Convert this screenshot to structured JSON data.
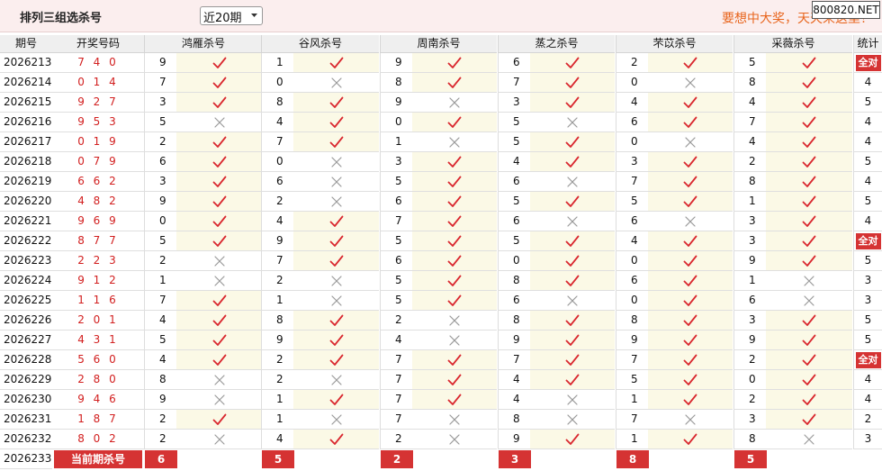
{
  "header": {
    "title": "排列三组选杀号",
    "range_value": "近20期",
    "promo": "要想中大奖，天天来这里！",
    "watermark": "800820.NET"
  },
  "columns": {
    "period": "期号",
    "number": "开奖号码",
    "groups": [
      "鸿雁杀号",
      "谷风杀号",
      "周南杀号",
      "蒸之杀号",
      "芣苡杀号",
      "采薇杀号"
    ],
    "stats": "统计"
  },
  "rows": [
    {
      "period": "2026213",
      "number": "7 4 0",
      "kills": [
        9,
        1,
        9,
        6,
        2,
        5
      ],
      "hits": [
        1,
        1,
        1,
        1,
        1,
        1
      ],
      "stat": "全对",
      "all": true
    },
    {
      "period": "2026214",
      "number": "0 1 4",
      "kills": [
        7,
        0,
        8,
        7,
        0,
        8
      ],
      "hits": [
        1,
        0,
        1,
        1,
        0,
        1
      ],
      "stat": "4",
      "all": false
    },
    {
      "period": "2026215",
      "number": "9 2 7",
      "kills": [
        3,
        8,
        9,
        3,
        4,
        4
      ],
      "hits": [
        1,
        1,
        0,
        1,
        1,
        1
      ],
      "stat": "5",
      "all": false
    },
    {
      "period": "2026216",
      "number": "9 5 3",
      "kills": [
        5,
        4,
        0,
        5,
        6,
        7
      ],
      "hits": [
        0,
        1,
        1,
        0,
        1,
        1
      ],
      "stat": "4",
      "all": false
    },
    {
      "period": "2026217",
      "number": "0 1 9",
      "kills": [
        2,
        7,
        1,
        5,
        0,
        4
      ],
      "hits": [
        1,
        1,
        0,
        1,
        0,
        1
      ],
      "stat": "4",
      "all": false
    },
    {
      "period": "2026218",
      "number": "0 7 9",
      "kills": [
        6,
        0,
        3,
        4,
        3,
        2
      ],
      "hits": [
        1,
        0,
        1,
        1,
        1,
        1
      ],
      "stat": "5",
      "all": false
    },
    {
      "period": "2026219",
      "number": "6 6 2",
      "kills": [
        3,
        6,
        5,
        6,
        7,
        8
      ],
      "hits": [
        1,
        0,
        1,
        0,
        1,
        1
      ],
      "stat": "4",
      "all": false
    },
    {
      "period": "2026220",
      "number": "4 8 2",
      "kills": [
        9,
        2,
        6,
        5,
        5,
        1
      ],
      "hits": [
        1,
        0,
        1,
        1,
        1,
        1
      ],
      "stat": "5",
      "all": false
    },
    {
      "period": "2026221",
      "number": "9 6 9",
      "kills": [
        0,
        4,
        7,
        6,
        6,
        3
      ],
      "hits": [
        1,
        1,
        1,
        0,
        0,
        1
      ],
      "stat": "4",
      "all": false
    },
    {
      "period": "2026222",
      "number": "8 7 7",
      "kills": [
        5,
        9,
        5,
        5,
        4,
        3
      ],
      "hits": [
        1,
        1,
        1,
        1,
        1,
        1
      ],
      "stat": "全对",
      "all": true
    },
    {
      "period": "2026223",
      "number": "2 2 3",
      "kills": [
        2,
        7,
        6,
        0,
        0,
        9
      ],
      "hits": [
        0,
        1,
        1,
        1,
        1,
        1
      ],
      "stat": "5",
      "all": false
    },
    {
      "period": "2026224",
      "number": "9 1 2",
      "kills": [
        1,
        2,
        5,
        8,
        6,
        1
      ],
      "hits": [
        0,
        0,
        1,
        1,
        1,
        0
      ],
      "stat": "3",
      "all": false
    },
    {
      "period": "2026225",
      "number": "1 1 6",
      "kills": [
        7,
        1,
        5,
        6,
        0,
        6
      ],
      "hits": [
        1,
        0,
        1,
        0,
        1,
        0
      ],
      "stat": "3",
      "all": false
    },
    {
      "period": "2026226",
      "number": "2 0 1",
      "kills": [
        4,
        8,
        2,
        8,
        8,
        3
      ],
      "hits": [
        1,
        1,
        0,
        1,
        1,
        1
      ],
      "stat": "5",
      "all": false
    },
    {
      "period": "2026227",
      "number": "4 3 1",
      "kills": [
        5,
        9,
        4,
        9,
        9,
        9
      ],
      "hits": [
        1,
        1,
        0,
        1,
        1,
        1
      ],
      "stat": "5",
      "all": false
    },
    {
      "period": "2026228",
      "number": "5 6 0",
      "kills": [
        4,
        2,
        7,
        7,
        7,
        2
      ],
      "hits": [
        1,
        1,
        1,
        1,
        1,
        1
      ],
      "stat": "全对",
      "all": true
    },
    {
      "period": "2026229",
      "number": "2 8 0",
      "kills": [
        8,
        2,
        7,
        4,
        5,
        0
      ],
      "hits": [
        0,
        0,
        1,
        1,
        1,
        1
      ],
      "stat": "4",
      "all": false
    },
    {
      "period": "2026230",
      "number": "9 4 6",
      "kills": [
        9,
        1,
        7,
        4,
        1,
        2
      ],
      "hits": [
        0,
        1,
        1,
        0,
        1,
        1
      ],
      "stat": "4",
      "all": false
    },
    {
      "period": "2026231",
      "number": "1 8 7",
      "kills": [
        2,
        1,
        7,
        8,
        7,
        3
      ],
      "hits": [
        1,
        0,
        0,
        0,
        0,
        1
      ],
      "stat": "2",
      "all": false
    },
    {
      "period": "2026232",
      "number": "8 0 2",
      "kills": [
        2,
        4,
        2,
        9,
        1,
        8
      ],
      "hits": [
        0,
        1,
        0,
        1,
        1,
        0
      ],
      "stat": "3",
      "all": false
    }
  ],
  "current": {
    "period": "2026233",
    "label": "当前期杀号",
    "kills": [
      "6",
      "5",
      "2",
      "3",
      "8",
      "5"
    ]
  },
  "colors": {
    "accent_red": "#d53333",
    "check_red": "#d9272e",
    "cross_gray": "#9a9a9a",
    "promo_orange": "#e8651d"
  }
}
